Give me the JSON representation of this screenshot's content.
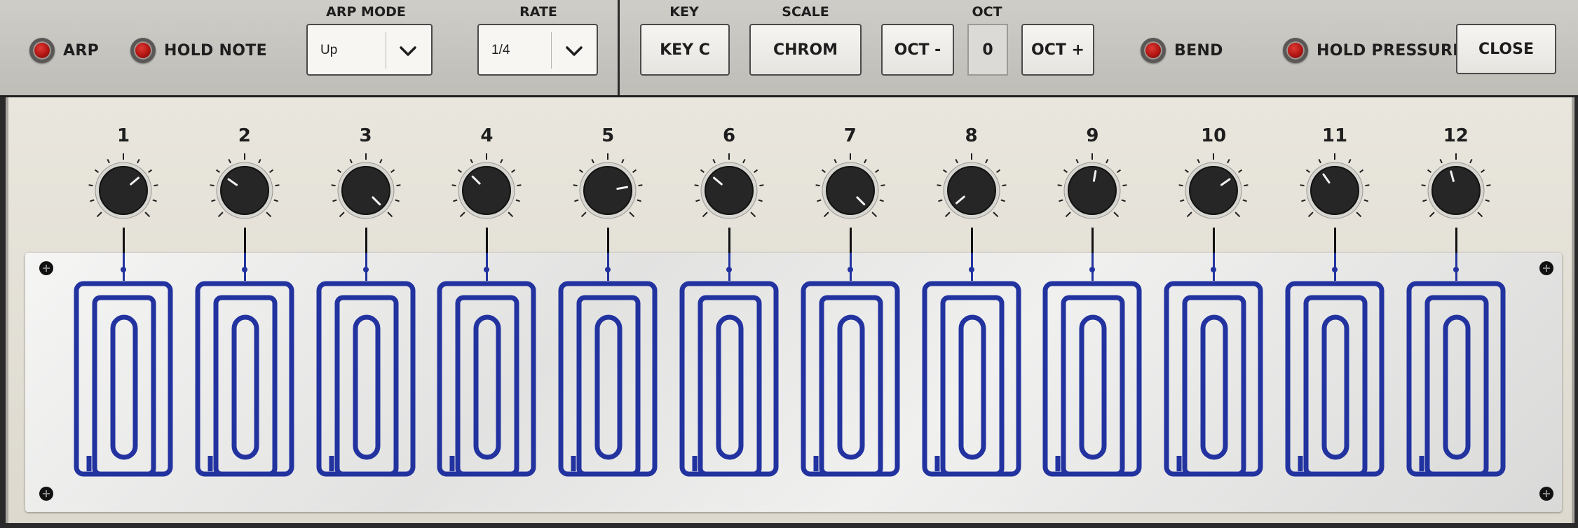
{
  "toolbar": {
    "arp": {
      "label": "ARP"
    },
    "hold_note": {
      "label": "HOLD NOTE"
    },
    "arp_mode": {
      "label": "ARP MODE",
      "value": "Up"
    },
    "rate": {
      "label": "RATE",
      "value": "1/4"
    },
    "key": {
      "label": "KEY",
      "button": "KEY C"
    },
    "scale": {
      "label": "SCALE",
      "button": "CHROM"
    },
    "oct": {
      "label": "OCT",
      "minus": "OCT -",
      "value": "0",
      "plus": "OCT +"
    },
    "bend": {
      "label": "BEND"
    },
    "hold_pressure": {
      "label": "HOLD PRESSURE"
    },
    "close": {
      "label": "CLOSE"
    }
  },
  "knobs": [
    {
      "label": "1",
      "angle": 50
    },
    {
      "label": "2",
      "angle": -55
    },
    {
      "label": "3",
      "angle": 135
    },
    {
      "label": "4",
      "angle": -45
    },
    {
      "label": "5",
      "angle": 80
    },
    {
      "label": "6",
      "angle": -50
    },
    {
      "label": "7",
      "angle": 135
    },
    {
      "label": "8",
      "angle": -130
    },
    {
      "label": "9",
      "angle": 10
    },
    {
      "label": "10",
      "angle": 55
    },
    {
      "label": "11",
      "angle": -35
    },
    {
      "label": "12",
      "angle": -15
    }
  ],
  "colors": {
    "led": "#c2201c",
    "pad": "#2233a0"
  },
  "icons": {
    "dropdown": "chevron-down-icon",
    "screw": "screw-icon"
  }
}
